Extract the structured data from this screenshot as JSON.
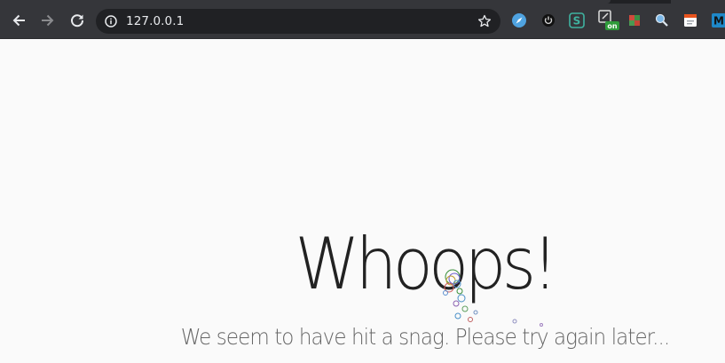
{
  "browser": {
    "url": "127.0.0.1",
    "extension_badge_text": "on",
    "extension_s_label": "S",
    "extension_m_label": "M"
  },
  "error_page": {
    "title": "Whoops!",
    "message": "We seem to have hit a snag. Please try again later..."
  },
  "colors": {
    "toolbar": "#35363a",
    "omnibox": "#202124",
    "page_background": "#fafafa",
    "title_text": "#222222",
    "message_text": "#666666"
  }
}
